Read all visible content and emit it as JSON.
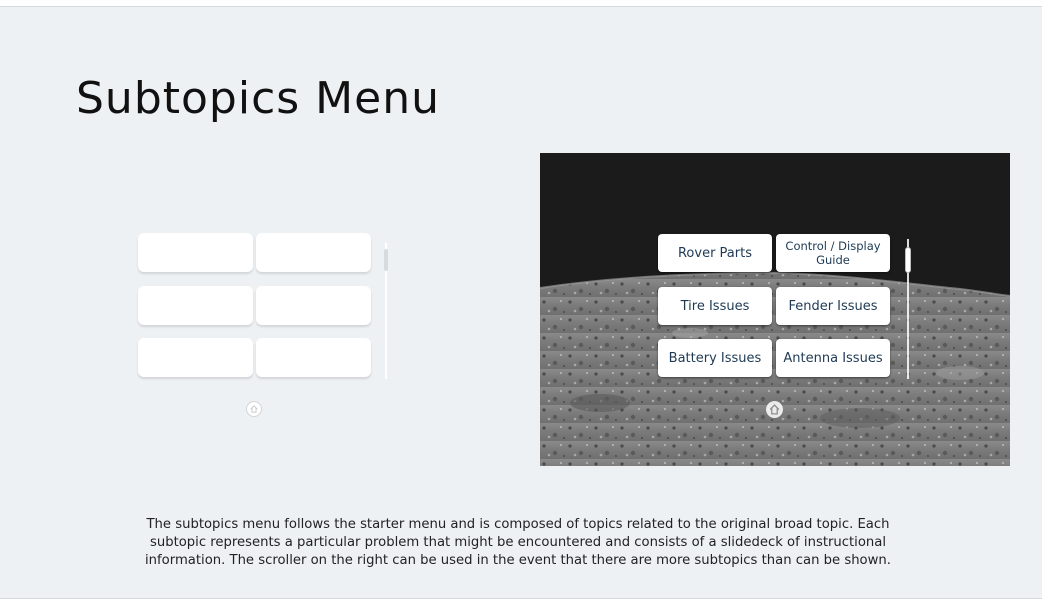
{
  "slide": {
    "title": "Subtopics Menu",
    "caption": "The subtopics menu follows the starter menu and is composed of topics related to the original broad topic. Each subtopic represents a particular problem that might be encountered and consists of a slidedeck of instructional information. The scroller on the right can be used in the event that there are more subtopics than can be shown."
  },
  "screenshot_menu": {
    "buttons": [
      "Rover Parts",
      "Control / Display Guide",
      "Tire Issues",
      "Fender Issues",
      "Battery Issues",
      "Antenna Issues"
    ],
    "icons": {
      "home": "home-icon",
      "scroller": "scrollbar"
    },
    "colors": {
      "button_text": "#1e3a55",
      "background": "#eef1f4",
      "sky": "#1b1b1b"
    }
  }
}
